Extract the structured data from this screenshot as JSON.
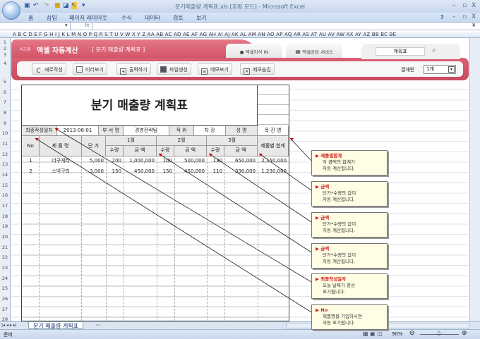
{
  "window": {
    "title": "분기매출량 계획표.xls  [호환 모드] - Microsoft Excel",
    "minimize": "–",
    "restore": "▫",
    "close": "X"
  },
  "ribbon": {
    "tabs": [
      "홈",
      "삽입",
      "페이지 레이아웃",
      "수식",
      "데이터",
      "검토",
      "보기"
    ],
    "help": "?"
  },
  "formula_bar": {
    "name_box": "",
    "fx": "fx",
    "value": ""
  },
  "columns": "A B C D E F G H I J K L M N O P Q R S T U V W X Y Z AA AB AC AD AE AF AG AH AI AJ AK AL AM AN AO AP AQ AR AS AT AU AV AW AX AY AZ BB BC BE",
  "rows": [
    "1",
    "2",
    "3",
    "4",
    "5",
    "6",
    "7",
    "8",
    "9",
    "10",
    "11",
    "12",
    "13",
    "14",
    "15",
    "16",
    "17",
    "18",
    "19",
    "20",
    "21",
    "22",
    "23",
    "24",
    "25",
    "26",
    "27",
    "28"
  ],
  "banner": {
    "brand_small": "비즈폼",
    "brand": "엑셀 자동계산",
    "subtitle": "[ 분기 매출량 계획표 ]",
    "tab1": "엑셀지식 IN",
    "tab2": "엑셀상담 서비스",
    "search_value": "계획표",
    "buttons": [
      "새로작성",
      "미리보기",
      "출력하기",
      "파일생성",
      "메모보기",
      "메모숨김"
    ],
    "approval_label": "결재란",
    "approval_value": "1개"
  },
  "sheet": {
    "title": "분기 매출량 계획표",
    "info": {
      "date_label": "최종작성일자",
      "date": "2013-08-01",
      "dept_label": "부 서 명",
      "dept": "경영전략팀",
      "pos_label": "직    위",
      "pos": "차 장",
      "name_label": "성    명",
      "name": "목 진 영"
    },
    "headers": {
      "no": "No",
      "product": "제 품 명",
      "price": "단 가",
      "m1": "1월",
      "m2": "2월",
      "m3": "3월",
      "qty": "수량",
      "amount": "금  액",
      "total": "제품별 합계"
    },
    "rows": [
      {
        "no": "1",
        "product": "너구게티",
        "price": "5,000",
        "q1": "200",
        "a1": "1,000,000",
        "q2": "100",
        "a2": "500,000",
        "q3": "130",
        "a3": "650,000",
        "total": "2,150,000"
      },
      {
        "no": "2",
        "product": "스넥구리",
        "price": "3,000",
        "q1": "150",
        "a1": "450,000",
        "q2": "150",
        "a2": "450,000",
        "q3": "110",
        "a3": "330,000",
        "total": "1,230,000"
      }
    ]
  },
  "comments": [
    {
      "title": "제품별합계",
      "l1": "각 금액의 합계가",
      "l2": "자동 계산됩니다."
    },
    {
      "title": "금액",
      "l1": "단가*수량의 값이",
      "l2": "자동 계산됩니다."
    },
    {
      "title": "금액",
      "l1": "단가*수량의 값이",
      "l2": "자동 계산됩니다."
    },
    {
      "title": "금액",
      "l1": "단가*수량의 값이",
      "l2": "자동 계산됩니다."
    },
    {
      "title": "최종작성일자",
      "l1": "오늘 날짜가 항상",
      "l2": "표기됩니다."
    },
    {
      "title": "No",
      "l1": "제품명을 기입하시면",
      "l2": "자동 표기됩니다."
    }
  ],
  "sheet_tabs": {
    "active": "분기 매출량 계획표"
  },
  "status": {
    "ready": "준비",
    "zoom": "90%"
  }
}
